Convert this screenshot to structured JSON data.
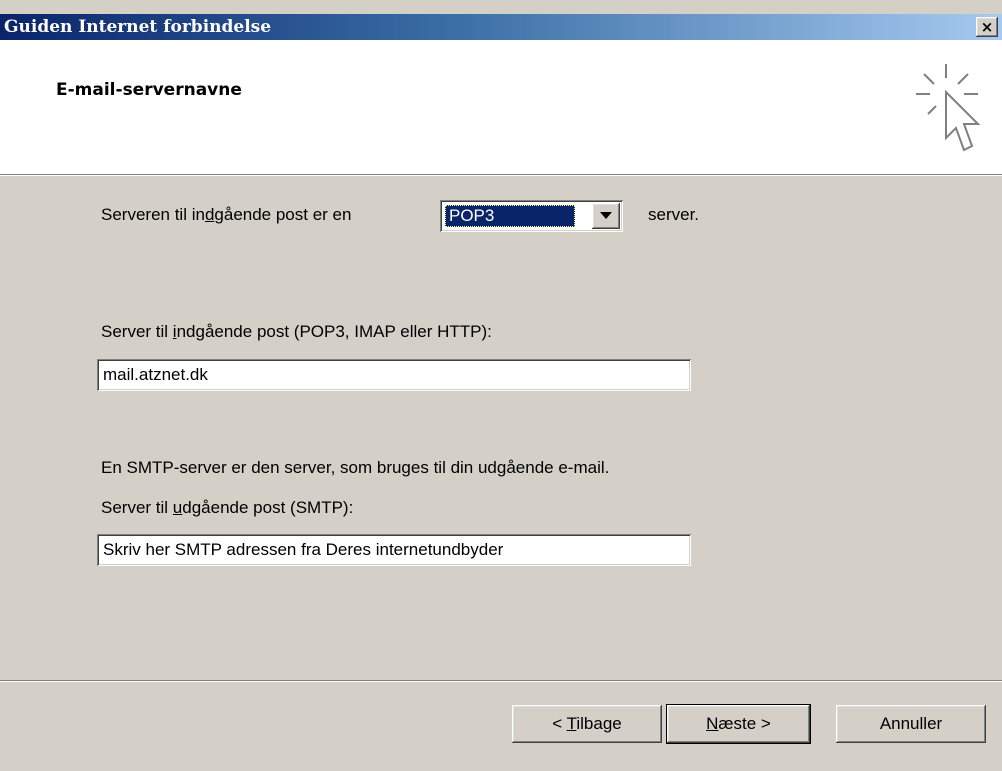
{
  "window": {
    "title": "Guiden Internet forbindelse",
    "close_label": "×"
  },
  "header": {
    "title": "E-mail-servernavne",
    "icon": "wizard-cursor-icon"
  },
  "incoming_type": {
    "prefix_before": "Serveren til in",
    "prefix_accel": "d",
    "prefix_after": "gående post er en",
    "selected": "POP3",
    "suffix": "server."
  },
  "incoming_server": {
    "label_before": "Server til ",
    "label_accel": "i",
    "label_after": "ndgående post (POP3, IMAP eller HTTP):",
    "value": "mail.atznet.dk"
  },
  "smtp_info": "En SMTP-server er den server, som bruges til din udgående e-mail.",
  "outgoing_server": {
    "label_before": "Server til ",
    "label_accel": "u",
    "label_after": "dgående post (SMTP):",
    "value": "Skriv her SMTP adressen fra Deres internetundbyder"
  },
  "buttons": {
    "back_before": "< ",
    "back_accel": "T",
    "back_after": "ilbage",
    "next_accel": "N",
    "next_after": "æste >",
    "cancel": "Annuller"
  }
}
